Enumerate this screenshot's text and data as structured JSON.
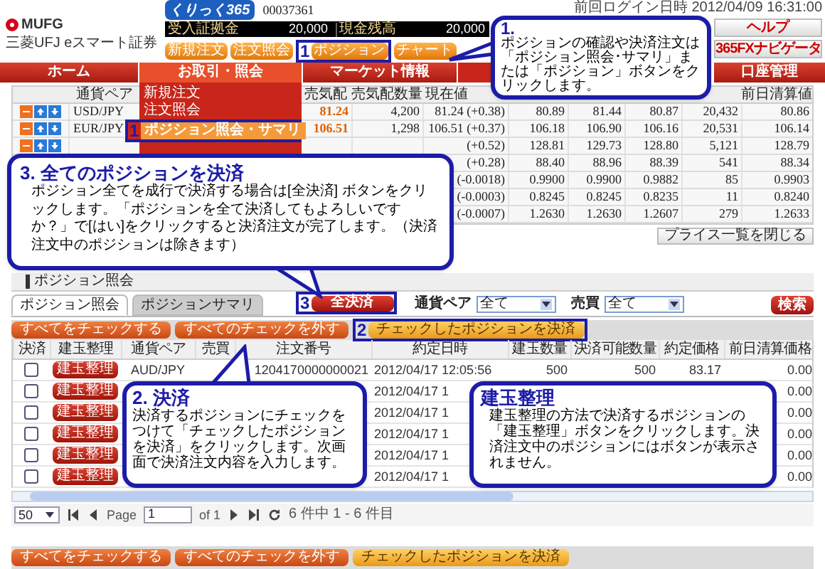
{
  "header": {
    "brand_name": "MUFG",
    "brand_subtitle": "三菱UFJ eスマート証券",
    "product_logo": "くりっく365",
    "account_number": "00037361",
    "balances": [
      {
        "label": "受入証拠金",
        "value": "20,000"
      },
      {
        "label": "現金残高",
        "value": "20,000"
      }
    ],
    "buttons": [
      {
        "label": "新規注文"
      },
      {
        "label": "注文照会"
      },
      {
        "label": "ポジション",
        "marker": "1"
      },
      {
        "label": "チャート"
      }
    ],
    "last_login": "前回ログイン日時 2012/04/09 16:31:00",
    "help": "ヘルプ",
    "navigator": "365FXナビゲータ"
  },
  "nav": [
    {
      "label": "ホーム",
      "selected": false
    },
    {
      "label": "お取引・照会",
      "selected": true
    },
    {
      "label": "マーケット情報",
      "selected": false
    },
    {
      "label": "口座管理",
      "selected": false
    }
  ],
  "nav_menu": [
    {
      "label": "新規注文",
      "selected": false
    },
    {
      "label": "注文照会",
      "selected": false
    },
    {
      "label": "ポジション照会・サマリ",
      "selected": true,
      "marker": "1"
    }
  ],
  "price_table": {
    "columns": {
      "pair": "通貨ペア",
      "bid": "売気配",
      "bid_size": "売気配数量",
      "current": "現在値",
      "prev_close": "前日清算値"
    },
    "rows": [
      {
        "icons": true,
        "pair": "USD/JPY",
        "bid": "81.24",
        "bid_size": "4,200",
        "current": "81.24 (+0.38)",
        "column_6": "80.89",
        "column_7": "81.44",
        "column_8": "80.87",
        "column_9": "20,432",
        "prev_close": "80.86"
      },
      {
        "icons": true,
        "pair": "EUR/JPY",
        "bid": "106.51",
        "bid_size": "1,298",
        "current": "106.51 (+0.37)",
        "column_6": "106.18",
        "column_7": "106.90",
        "column_8": "106.16",
        "column_9": "20,531",
        "prev_close": "106.14"
      },
      {
        "icons": true,
        "current": "(+0.52)",
        "column_6": "128.81",
        "column_7": "129.73",
        "column_8": "128.80",
        "column_9": "5,121",
        "prev_close": "128.79"
      },
      {
        "current": "(+0.28)",
        "column_6": "88.40",
        "column_7": "88.96",
        "column_8": "88.39",
        "column_9": "541",
        "prev_close": "88.34"
      },
      {
        "current": "(-0.0018)",
        "column_6": "0.9900",
        "column_7": "0.9900",
        "column_8": "0.9882",
        "column_9": "85",
        "prev_close": "0.9903"
      },
      {
        "current": "(-0.0003)",
        "column_6": "0.8245",
        "column_7": "0.8245",
        "column_8": "0.8235",
        "column_9": "11",
        "prev_close": "0.8240"
      },
      {
        "current": "(-0.0007)",
        "column_6": "1.2630",
        "column_7": "1.2630",
        "column_8": "1.2607",
        "column_9": "279",
        "prev_close": "1.2633"
      }
    ]
  },
  "close_prices_button": "プライス一覧を閉じる",
  "section_title": "ポジション照会",
  "tabs": [
    {
      "label": "ポジション照会",
      "selected": true
    },
    {
      "label": "ポジションサマリ",
      "selected": false
    }
  ],
  "close_all_button": {
    "label": "全決済",
    "marker": "3"
  },
  "filters": [
    {
      "label": "通貨ペア",
      "value": "全て"
    },
    {
      "label": "売買",
      "value": "全て"
    }
  ],
  "search_button": "検索",
  "action_bar_top": [
    {
      "label": "すべてをチェックする",
      "kind": "check"
    },
    {
      "label": "すべてのチェックを外す",
      "kind": "check"
    },
    {
      "label": "チェックしたポジションを決済",
      "kind": "submit",
      "marker": "2"
    }
  ],
  "position_table": {
    "columns": [
      "決済",
      "建玉整理",
      "通貨ペア",
      "売買",
      "注文番号",
      "約定日時",
      "建玉数量",
      "決済可能数量",
      "約定価格",
      "前日清算価格"
    ],
    "rows": [
      {
        "checked": false,
        "button": "建玉整理",
        "pair": "AUD/JPY",
        "order_no": "1204170000000021",
        "date": "2012/04/17 12:05:56",
        "qty": "500",
        "closable": "500",
        "price": "83.17",
        "prev": "0.00"
      },
      {
        "checked": false,
        "button": "建玉整理",
        "date": "2012/04/17 1",
        "prev": "0.00"
      },
      {
        "checked": false,
        "button": "建玉整理",
        "date": "2012/04/17 1",
        "prev": "0.00"
      },
      {
        "checked": false,
        "button": "建玉整理",
        "date": "2012/04/17 1",
        "prev": "0.00"
      },
      {
        "checked": false,
        "button": "建玉整理",
        "date": "2012/04/17 1",
        "prev": "0.00"
      },
      {
        "checked": false,
        "button": "建玉整理",
        "date": "2012/04/17 1",
        "prev": "0.00"
      }
    ]
  },
  "pagination": {
    "page_size": "50",
    "page_label": "Page",
    "page": "1",
    "of": "of 1",
    "summary": "6 件中 1 - 6 件目"
  },
  "action_bar_bottom": [
    {
      "label": "すべてをチェックする",
      "kind": "check"
    },
    {
      "label": "すべてのチェックを外す",
      "kind": "check"
    },
    {
      "label": "チェックしたポジションを決済",
      "kind": "submit"
    }
  ],
  "callouts": [
    {
      "title": "1.",
      "text": "ポジションの確認や決済注文は「ポジション照会･サマリ」または「ポジション」ボタンをクリックします。"
    },
    {
      "title": "3. 全てのポジションを決済",
      "text": "ポジション全てを成行で決済する場合は[全決済] ボタンをクリックします。「ポジションを全て決済してもよろしいですか？」で[はい]をクリックすると決済注文が完了します。（決済注文中のポジションは除きます）"
    },
    {
      "title": "2. 決済",
      "text": "決済するポジションにチェックをつけて「チェックしたポジションを決済」をクリックします。次画面で決済注文内容を入力します。"
    },
    {
      "title": "建玉整理",
      "text": "建玉整理の方法で決済するポジションの「建玉整理」ボタンをクリックします。決済注文中のポジションにはボタンが表示されません。"
    }
  ]
}
